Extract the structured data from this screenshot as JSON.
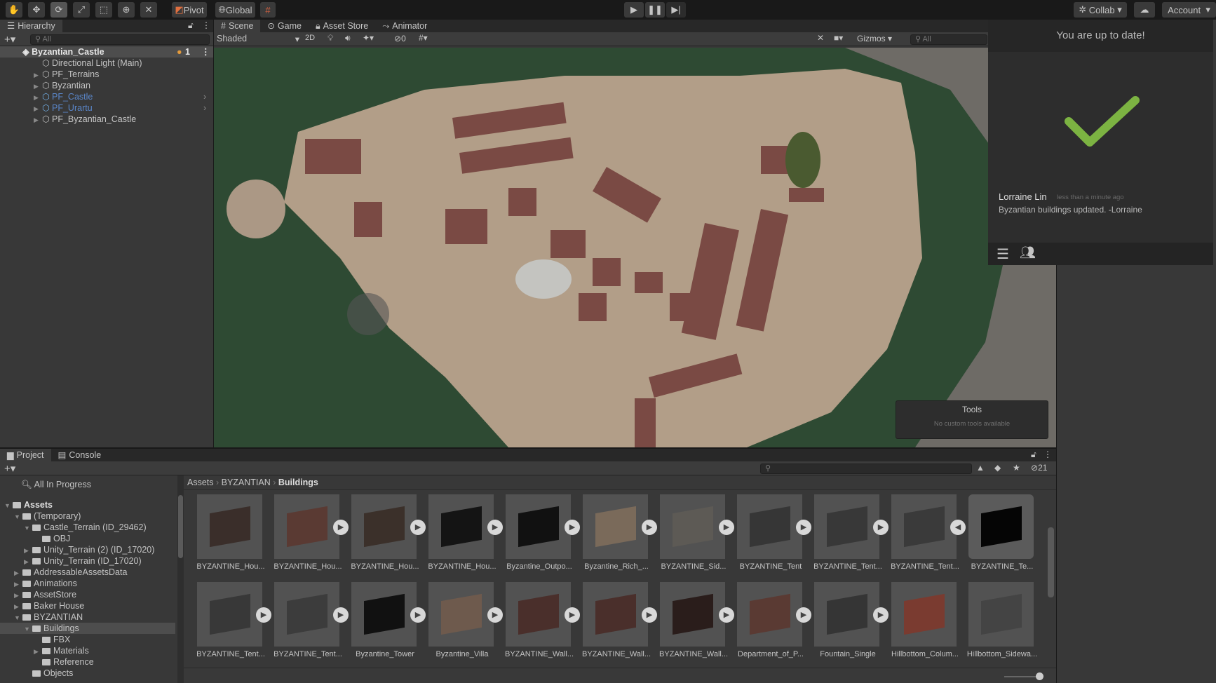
{
  "toolbar": {
    "pivot": "Pivot",
    "global": "Global",
    "collab": "Collab",
    "account": "Account"
  },
  "hierarchy": {
    "tab": "Hierarchy",
    "search_placeholder": "All",
    "scene": "Byzantian_Castle",
    "user_count": "1",
    "items": [
      {
        "label": "Directional Light (Main)",
        "expand": false,
        "prefab": false
      },
      {
        "label": "PF_Terrains",
        "expand": true,
        "prefab": false
      },
      {
        "label": "Byzantian",
        "expand": true,
        "prefab": false
      },
      {
        "label": "PF_Castle",
        "expand": true,
        "prefab": true
      },
      {
        "label": "PF_Urartu",
        "expand": true,
        "prefab": true
      },
      {
        "label": "PF_Byzantian_Castle",
        "expand": true,
        "prefab": false
      }
    ]
  },
  "scene": {
    "tabs": [
      "Scene",
      "Game",
      "Asset Store",
      "Animator"
    ],
    "shading": "Shaded",
    "mode_2d": "2D",
    "hidden_count": "0",
    "gizmos": "Gizmos",
    "search_placeholder": "All",
    "tools_overlay": {
      "title": "Tools",
      "subtitle": "No custom tools available"
    }
  },
  "collab": {
    "status": "You are up to date!",
    "author": "Lorraine Lin",
    "time": "less than a minute ago",
    "message": "Byzantian buildings updated. -Lorraine",
    "check_color": "#7cb342"
  },
  "project": {
    "tabs": [
      "Project",
      "Console"
    ],
    "hidden_count": "21",
    "all_in_progress": "All In Progress",
    "breadcrumb": [
      "Assets",
      "BYZANTIAN",
      "Buildings"
    ],
    "tree": [
      {
        "label": "Assets",
        "indent": 0,
        "tri": "▼",
        "bold": true
      },
      {
        "label": "(Temporary)",
        "indent": 1,
        "tri": "▼"
      },
      {
        "label": "Castle_Terrain (ID_29462)",
        "indent": 2,
        "tri": "▼"
      },
      {
        "label": "OBJ",
        "indent": 3,
        "tri": ""
      },
      {
        "label": "Unity_Terrain (2) (ID_17020)",
        "indent": 2,
        "tri": "▶"
      },
      {
        "label": "Unity_Terrain (ID_17020)",
        "indent": 2,
        "tri": "▶"
      },
      {
        "label": "AddressableAssetsData",
        "indent": 1,
        "tri": "▶"
      },
      {
        "label": "Animations",
        "indent": 1,
        "tri": "▶"
      },
      {
        "label": "AssetStore",
        "indent": 1,
        "tri": "▶"
      },
      {
        "label": "Baker House",
        "indent": 1,
        "tri": "▶"
      },
      {
        "label": "BYZANTIAN",
        "indent": 1,
        "tri": "▼"
      },
      {
        "label": "Buildings",
        "indent": 2,
        "tri": "▼",
        "selected": true
      },
      {
        "label": "FBX",
        "indent": 3,
        "tri": ""
      },
      {
        "label": "Materials",
        "indent": 3,
        "tri": "▶"
      },
      {
        "label": "Reference",
        "indent": 3,
        "tri": ""
      },
      {
        "label": "Objects",
        "indent": 2,
        "tri": ""
      }
    ],
    "assets": [
      {
        "label": "BYZANTINE_Hou...",
        "arrow": "",
        "color": "#3a2e2a"
      },
      {
        "label": "BYZANTINE_Hou...",
        "arrow": "▶",
        "color": "#5a3a33"
      },
      {
        "label": "BYZANTINE_Hou...",
        "arrow": "▶",
        "color": "#3b302a"
      },
      {
        "label": "BYZANTINE_Hou...",
        "arrow": "▶",
        "color": "#141414"
      },
      {
        "label": "Byzantine_Outpo...",
        "arrow": "▶",
        "color": "#111111"
      },
      {
        "label": "Byzantine_Rich_...",
        "arrow": "▶",
        "color": "#7a6a5a"
      },
      {
        "label": "BYZANTINE_Sid...",
        "arrow": "▶",
        "color": "#5d5a55"
      },
      {
        "label": "BYZANTINE_Tent",
        "arrow": "▶",
        "color": "#363636"
      },
      {
        "label": "BYZANTINE_Tent...",
        "arrow": "▶",
        "color": "#383838"
      },
      {
        "label": "BYZANTINE_Tent...",
        "arrow": "◀",
        "color": "#3a3a3a"
      },
      {
        "label": "BYZANTINE_Te...",
        "arrow": "",
        "color": "#050505",
        "selected": true
      },
      {
        "label": "BYZANTINE_Tent...",
        "arrow": "▶",
        "color": "#383838"
      },
      {
        "label": "BYZANTINE_Tent...",
        "arrow": "▶",
        "color": "#3c3c3c"
      },
      {
        "label": "Byzantine_Tower",
        "arrow": "▶",
        "color": "#111111"
      },
      {
        "label": "Byzantine_Villa",
        "arrow": "▶",
        "color": "#6e5a4d"
      },
      {
        "label": "BYZANTINE_Wall...",
        "arrow": "▶",
        "color": "#4a2f2b"
      },
      {
        "label": "BYZANTINE_Wall...",
        "arrow": "▶",
        "color": "#4a2f2b"
      },
      {
        "label": "BYZANTINE_Wall...",
        "arrow": "▶",
        "color": "#2a1d1b"
      },
      {
        "label": "Department_of_P...",
        "arrow": "▶",
        "color": "#5a3a33"
      },
      {
        "label": "Fountain_Single",
        "arrow": "▶",
        "color": "#353535"
      },
      {
        "label": "Hillbottom_Colum...",
        "arrow": "",
        "color": "#7a3b30"
      },
      {
        "label": "Hillbottom_Sidewa...",
        "arrow": "",
        "color": "#444444"
      }
    ]
  }
}
